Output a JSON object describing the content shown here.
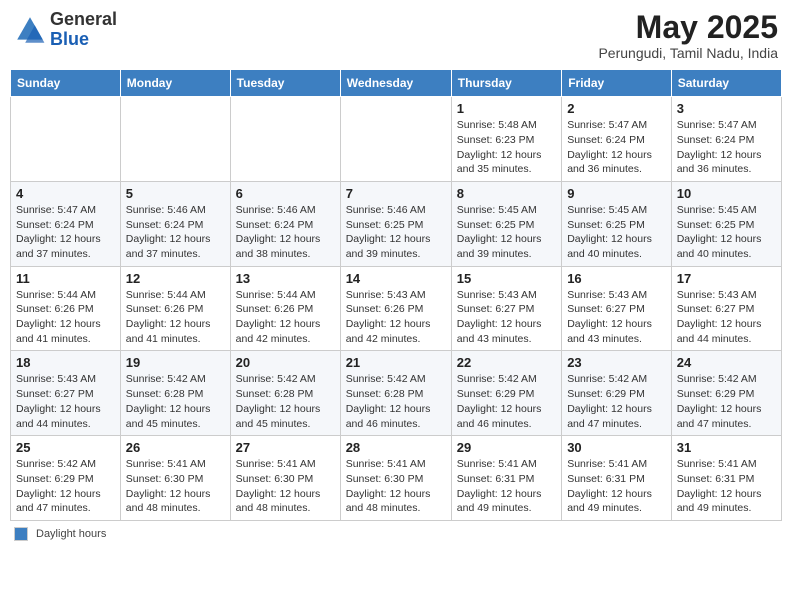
{
  "header": {
    "logo_line1": "General",
    "logo_line2": "Blue",
    "month": "May 2025",
    "location": "Perungudi, Tamil Nadu, India"
  },
  "weekdays": [
    "Sunday",
    "Monday",
    "Tuesday",
    "Wednesday",
    "Thursday",
    "Friday",
    "Saturday"
  ],
  "footer_label": "Daylight hours",
  "weeks": [
    [
      {
        "day": "",
        "detail": ""
      },
      {
        "day": "",
        "detail": ""
      },
      {
        "day": "",
        "detail": ""
      },
      {
        "day": "",
        "detail": ""
      },
      {
        "day": "1",
        "detail": "Sunrise: 5:48 AM\nSunset: 6:23 PM\nDaylight: 12 hours\nand 35 minutes."
      },
      {
        "day": "2",
        "detail": "Sunrise: 5:47 AM\nSunset: 6:24 PM\nDaylight: 12 hours\nand 36 minutes."
      },
      {
        "day": "3",
        "detail": "Sunrise: 5:47 AM\nSunset: 6:24 PM\nDaylight: 12 hours\nand 36 minutes."
      }
    ],
    [
      {
        "day": "4",
        "detail": "Sunrise: 5:47 AM\nSunset: 6:24 PM\nDaylight: 12 hours\nand 37 minutes."
      },
      {
        "day": "5",
        "detail": "Sunrise: 5:46 AM\nSunset: 6:24 PM\nDaylight: 12 hours\nand 37 minutes."
      },
      {
        "day": "6",
        "detail": "Sunrise: 5:46 AM\nSunset: 6:24 PM\nDaylight: 12 hours\nand 38 minutes."
      },
      {
        "day": "7",
        "detail": "Sunrise: 5:46 AM\nSunset: 6:25 PM\nDaylight: 12 hours\nand 39 minutes."
      },
      {
        "day": "8",
        "detail": "Sunrise: 5:45 AM\nSunset: 6:25 PM\nDaylight: 12 hours\nand 39 minutes."
      },
      {
        "day": "9",
        "detail": "Sunrise: 5:45 AM\nSunset: 6:25 PM\nDaylight: 12 hours\nand 40 minutes."
      },
      {
        "day": "10",
        "detail": "Sunrise: 5:45 AM\nSunset: 6:25 PM\nDaylight: 12 hours\nand 40 minutes."
      }
    ],
    [
      {
        "day": "11",
        "detail": "Sunrise: 5:44 AM\nSunset: 6:26 PM\nDaylight: 12 hours\nand 41 minutes."
      },
      {
        "day": "12",
        "detail": "Sunrise: 5:44 AM\nSunset: 6:26 PM\nDaylight: 12 hours\nand 41 minutes."
      },
      {
        "day": "13",
        "detail": "Sunrise: 5:44 AM\nSunset: 6:26 PM\nDaylight: 12 hours\nand 42 minutes."
      },
      {
        "day": "14",
        "detail": "Sunrise: 5:43 AM\nSunset: 6:26 PM\nDaylight: 12 hours\nand 42 minutes."
      },
      {
        "day": "15",
        "detail": "Sunrise: 5:43 AM\nSunset: 6:27 PM\nDaylight: 12 hours\nand 43 minutes."
      },
      {
        "day": "16",
        "detail": "Sunrise: 5:43 AM\nSunset: 6:27 PM\nDaylight: 12 hours\nand 43 minutes."
      },
      {
        "day": "17",
        "detail": "Sunrise: 5:43 AM\nSunset: 6:27 PM\nDaylight: 12 hours\nand 44 minutes."
      }
    ],
    [
      {
        "day": "18",
        "detail": "Sunrise: 5:43 AM\nSunset: 6:27 PM\nDaylight: 12 hours\nand 44 minutes."
      },
      {
        "day": "19",
        "detail": "Sunrise: 5:42 AM\nSunset: 6:28 PM\nDaylight: 12 hours\nand 45 minutes."
      },
      {
        "day": "20",
        "detail": "Sunrise: 5:42 AM\nSunset: 6:28 PM\nDaylight: 12 hours\nand 45 minutes."
      },
      {
        "day": "21",
        "detail": "Sunrise: 5:42 AM\nSunset: 6:28 PM\nDaylight: 12 hours\nand 46 minutes."
      },
      {
        "day": "22",
        "detail": "Sunrise: 5:42 AM\nSunset: 6:29 PM\nDaylight: 12 hours\nand 46 minutes."
      },
      {
        "day": "23",
        "detail": "Sunrise: 5:42 AM\nSunset: 6:29 PM\nDaylight: 12 hours\nand 47 minutes."
      },
      {
        "day": "24",
        "detail": "Sunrise: 5:42 AM\nSunset: 6:29 PM\nDaylight: 12 hours\nand 47 minutes."
      }
    ],
    [
      {
        "day": "25",
        "detail": "Sunrise: 5:42 AM\nSunset: 6:29 PM\nDaylight: 12 hours\nand 47 minutes."
      },
      {
        "day": "26",
        "detail": "Sunrise: 5:41 AM\nSunset: 6:30 PM\nDaylight: 12 hours\nand 48 minutes."
      },
      {
        "day": "27",
        "detail": "Sunrise: 5:41 AM\nSunset: 6:30 PM\nDaylight: 12 hours\nand 48 minutes."
      },
      {
        "day": "28",
        "detail": "Sunrise: 5:41 AM\nSunset: 6:30 PM\nDaylight: 12 hours\nand 48 minutes."
      },
      {
        "day": "29",
        "detail": "Sunrise: 5:41 AM\nSunset: 6:31 PM\nDaylight: 12 hours\nand 49 minutes."
      },
      {
        "day": "30",
        "detail": "Sunrise: 5:41 AM\nSunset: 6:31 PM\nDaylight: 12 hours\nand 49 minutes."
      },
      {
        "day": "31",
        "detail": "Sunrise: 5:41 AM\nSunset: 6:31 PM\nDaylight: 12 hours\nand 49 minutes."
      }
    ]
  ]
}
